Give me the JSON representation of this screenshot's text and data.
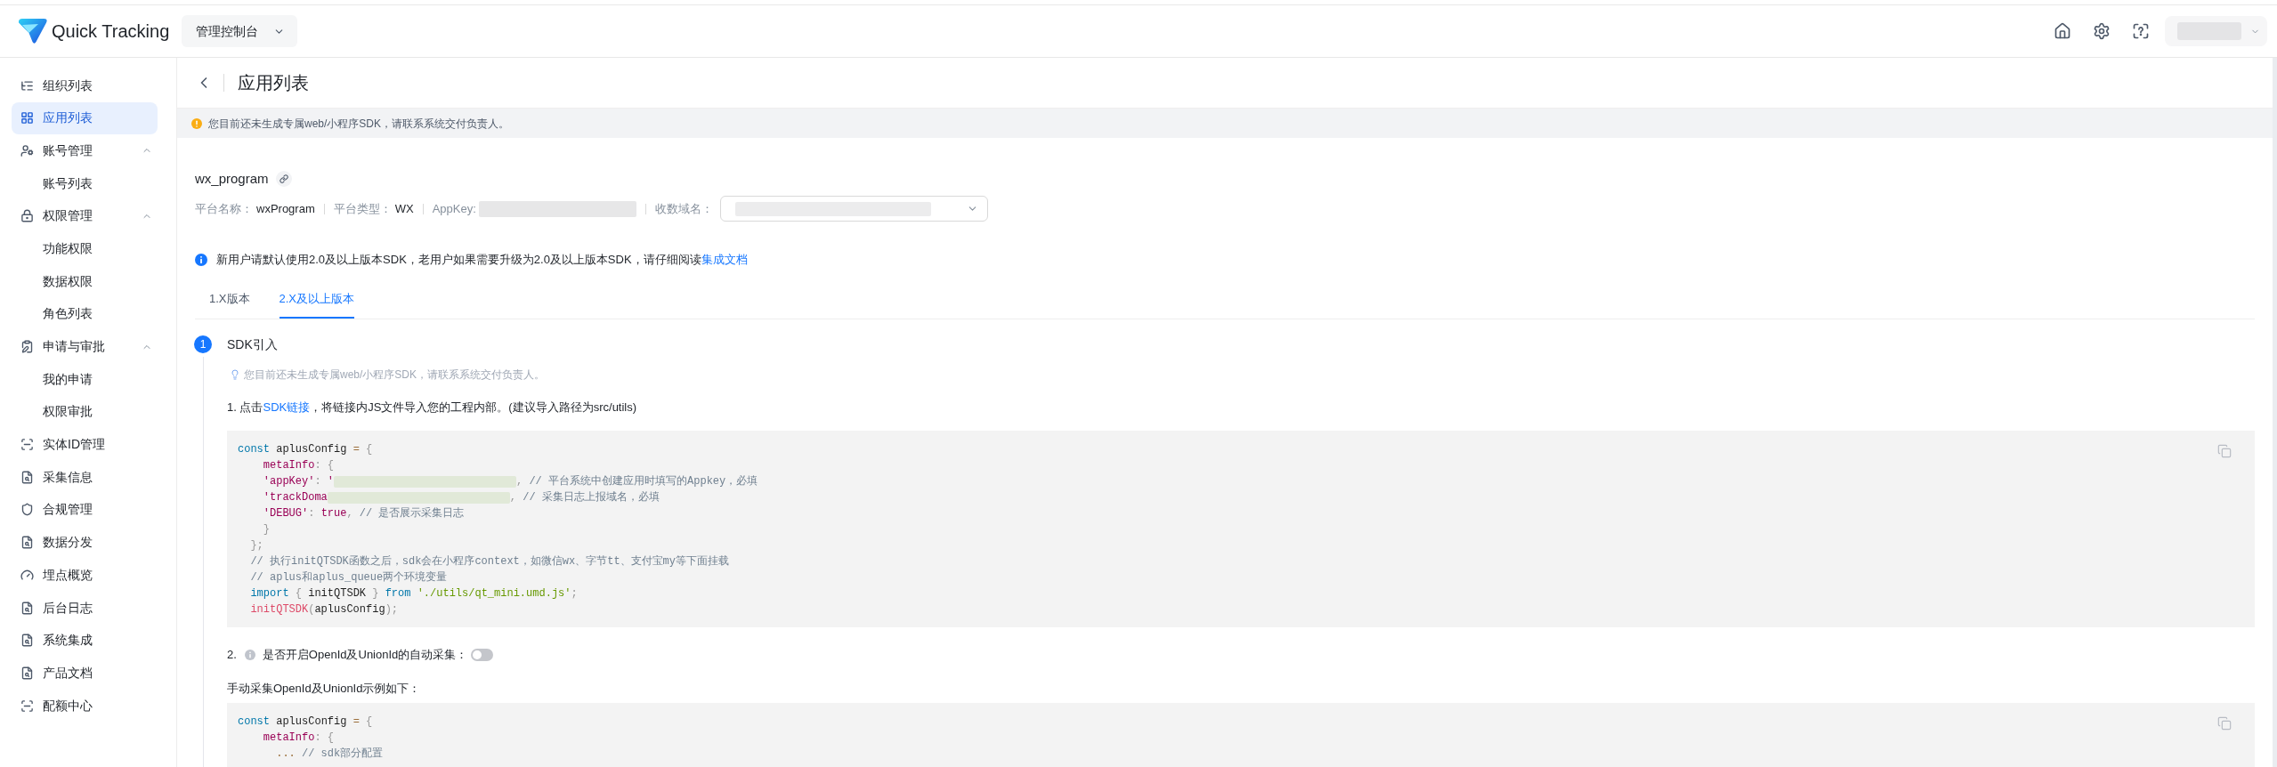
{
  "header": {
    "product_name": "Quick Tracking",
    "workspace_dropdown": "管理控制台"
  },
  "sidebar": {
    "items": [
      {
        "label": "组织列表",
        "selected": false
      },
      {
        "label": "应用列表",
        "selected": true
      },
      {
        "label": "账号管理",
        "selected": false,
        "expanded": true,
        "children": [
          {
            "label": "账号列表",
            "selected": false
          }
        ]
      },
      {
        "label": "权限管理",
        "selected": false,
        "expanded": true,
        "children": [
          {
            "label": "功能权限",
            "selected": false
          },
          {
            "label": "数据权限",
            "selected": false
          },
          {
            "label": "角色列表",
            "selected": false
          }
        ]
      },
      {
        "label": "申请与审批",
        "selected": false,
        "expanded": true,
        "children": [
          {
            "label": "我的申请",
            "selected": false
          },
          {
            "label": "权限审批",
            "selected": false
          }
        ]
      },
      {
        "label": "实体ID管理",
        "selected": false
      },
      {
        "label": "采集信息",
        "selected": false
      },
      {
        "label": "合规管理",
        "selected": false
      },
      {
        "label": "数据分发",
        "selected": false
      },
      {
        "label": "埋点概览",
        "selected": false
      },
      {
        "label": "后台日志",
        "selected": false
      },
      {
        "label": "系统集成",
        "selected": false
      },
      {
        "label": "产品文档",
        "selected": false
      },
      {
        "label": "配额中心",
        "selected": false
      }
    ]
  },
  "page": {
    "title": "应用列表",
    "notice": "您目前还未生成专属web/小程序SDK，请联系系统交付负责人。"
  },
  "app": {
    "name": "wx_program",
    "fields": [
      {
        "kind": "text",
        "label": "平台名称：",
        "value": "wxProgram"
      },
      {
        "kind": "text",
        "label": "平台类型：",
        "value": "WX"
      },
      {
        "kind": "redacted",
        "label": "AppKey:"
      },
      {
        "kind": "select",
        "label": "收数域名："
      }
    ]
  },
  "alert": {
    "text": "新用户请默认使用2.0及以上版本SDK，老用户如果需要升级为2.0及以上版本SDK，请仔细阅读",
    "link": "集成文档"
  },
  "tabs": [
    {
      "label": "1.X版本",
      "selected": false
    },
    {
      "label": "2.X及以上版本",
      "selected": true
    }
  ],
  "steps": [
    {
      "number": "1",
      "title": "SDK引入",
      "blocks": [
        {
          "kind": "tip",
          "text": "您目前还未生成专属web/小程序SDK，请联系系统交付负责人。"
        },
        {
          "kind": "link_text",
          "prefix": "1. 点击",
          "link": "SDK链接",
          "suffix": "，将链接内JS文件导入您的工程内部。(建议导入路径为src/utils)"
        },
        {
          "kind": "code",
          "lines": [
            {
              "tokens": [
                {
                  "kind": "keyword",
                  "text": "const"
                },
                {
                  "kind": "plain",
                  "text": " aplusConfig "
                },
                {
                  "kind": "operator",
                  "text": "="
                },
                {
                  "kind": "punctuation",
                  "text": " {"
                }
              ]
            },
            {
              "tokens": [
                {
                  "kind": "property",
                  "text": "    metaInfo"
                },
                {
                  "kind": "punctuation",
                  "text": ": {"
                }
              ]
            },
            {
              "tokens": [
                {
                  "kind": "property",
                  "text": "    'appKey'"
                },
                {
                  "kind": "punctuation",
                  "text": ": "
                },
                {
                  "kind": "property",
                  "text": "'"
                },
                {
                  "kind": "redacted"
                },
                {
                  "kind": "punctuation",
                  "text": ", "
                },
                {
                  "kind": "comment",
                  "text": "// 平台系统中创建应用时填写的Appkey，必填"
                }
              ]
            },
            {
              "tokens": [
                {
                  "kind": "property",
                  "text": "    'trackDoma"
                },
                {
                  "kind": "redacted"
                },
                {
                  "kind": "punctuation",
                  "text": ", "
                },
                {
                  "kind": "comment",
                  "text": "// 采集日志上报域名，必填"
                }
              ]
            },
            {
              "tokens": [
                {
                  "kind": "property",
                  "text": "    'DEBUG'"
                },
                {
                  "kind": "punctuation",
                  "text": ": "
                },
                {
                  "kind": "boolean",
                  "text": "true"
                },
                {
                  "kind": "punctuation",
                  "text": ", "
                },
                {
                  "kind": "comment",
                  "text": "// 是否展示采集日志"
                }
              ]
            },
            {
              "tokens": [
                {
                  "kind": "punctuation",
                  "text": "    }"
                }
              ]
            },
            {
              "tokens": [
                {
                  "kind": "punctuation",
                  "text": "  };"
                }
              ]
            },
            {
              "tokens": [
                {
                  "kind": "comment",
                  "text": "  // 执行initQTSDK函数之后，sdk会在小程序context，如微信wx、字节tt、支付宝my等下面挂载"
                }
              ]
            },
            {
              "tokens": [
                {
                  "kind": "comment",
                  "text": "  // aplus和aplus_queue两个环境变量"
                }
              ]
            },
            {
              "tokens": [
                {
                  "kind": "keyword",
                  "text": "  import"
                },
                {
                  "kind": "punctuation",
                  "text": " { "
                },
                {
                  "kind": "plain",
                  "text": "initQTSDK"
                },
                {
                  "kind": "punctuation",
                  "text": " } "
                },
                {
                  "kind": "keyword",
                  "text": "from"
                },
                {
                  "kind": "string",
                  "text": " './utils/qt_mini.umd.js'"
                },
                {
                  "kind": "punctuation",
                  "text": ";"
                }
              ]
            },
            {
              "tokens": [
                {
                  "kind": "function",
                  "text": "  initQTSDK"
                },
                {
                  "kind": "punctuation",
                  "text": "("
                },
                {
                  "kind": "plain",
                  "text": "aplusConfig"
                },
                {
                  "kind": "punctuation",
                  "text": ");"
                }
              ]
            }
          ]
        },
        {
          "kind": "toggle",
          "number": "2.",
          "label": "是否开启OpenId及UnionId的自动采集：",
          "on": false
        },
        {
          "kind": "text",
          "text": "手动采集OpenId及UnionId示例如下："
        },
        {
          "kind": "code",
          "lines": [
            {
              "tokens": [
                {
                  "kind": "keyword",
                  "text": "const"
                },
                {
                  "kind": "plain",
                  "text": " aplusConfig "
                },
                {
                  "kind": "operator",
                  "text": "="
                },
                {
                  "kind": "punctuation",
                  "text": " {"
                }
              ]
            },
            {
              "tokens": [
                {
                  "kind": "property",
                  "text": "    metaInfo"
                },
                {
                  "kind": "punctuation",
                  "text": ": {"
                }
              ]
            },
            {
              "tokens": [
                {
                  "kind": "operator",
                  "text": "      ..."
                },
                {
                  "kind": "comment",
                  "text": " // sdk部分配置"
                }
              ]
            }
          ]
        }
      ]
    }
  ]
}
